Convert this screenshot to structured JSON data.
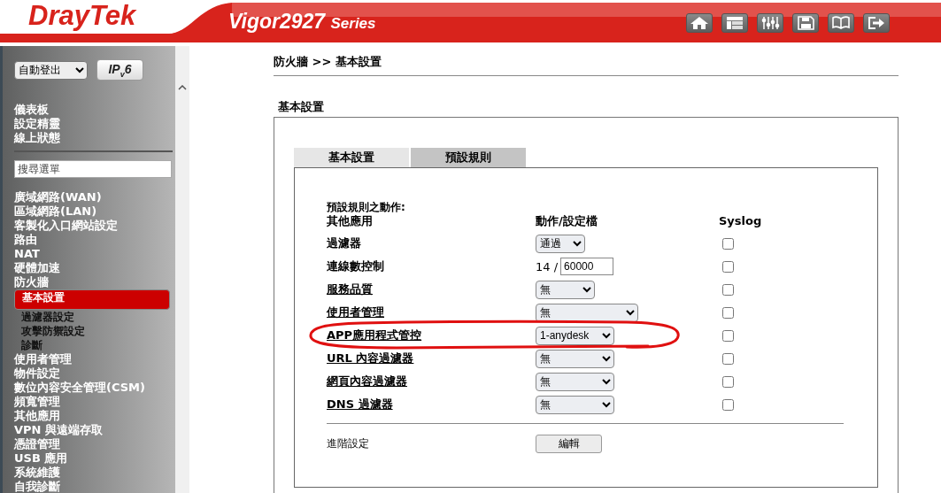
{
  "header": {
    "logo": "DrayTek",
    "model": "Vigor2927",
    "series": "Series"
  },
  "sidebar": {
    "logout_select": "自動登出",
    "ipv6_button": "IP$_{v}$6",
    "top_items": [
      {
        "label": "儀表板",
        "selected": false
      },
      {
        "label": "設定精靈",
        "selected": false
      },
      {
        "label": "線上狀態",
        "selected": false
      }
    ],
    "search": {
      "placeholder": "搜尋選單"
    },
    "menu": [
      {
        "label": "廣域網路(WAN)",
        "selected": false
      },
      {
        "label": "區域網路(LAN)",
        "selected": false
      },
      {
        "label": "客製化入口網站設定",
        "selected": false
      },
      {
        "label": "路由",
        "selected": false
      },
      {
        "label": "NAT",
        "selected": false
      },
      {
        "label": "硬體加速",
        "selected": false
      },
      {
        "label": "防火牆",
        "selected": false,
        "children": [
          {
            "label": "基本設置",
            "selected": true
          },
          {
            "label": "過濾器設定",
            "selected": false
          },
          {
            "label": "攻擊防禦設定",
            "selected": false
          },
          {
            "label": "診斷",
            "selected": false
          }
        ]
      },
      {
        "label": "使用者管理",
        "selected": false
      },
      {
        "label": "物件設定",
        "selected": false
      },
      {
        "label": "數位內容安全管理(CSM)",
        "selected": false
      },
      {
        "label": "頻寬管理",
        "selected": false
      },
      {
        "label": "其他應用",
        "selected": false
      },
      {
        "label": "VPN 與遠端存取",
        "selected": false
      },
      {
        "label": "憑證管理",
        "selected": false
      },
      {
        "label": "USB 應用",
        "selected": false
      },
      {
        "label": "系統維護",
        "selected": false
      },
      {
        "label": "自我診斷",
        "selected": false
      }
    ]
  },
  "content": {
    "breadcrumb": "防火牆 >> 基本設置",
    "section_title": "基本設置",
    "tabs": [
      {
        "label": "基本設置",
        "selected": false
      },
      {
        "label": "預設規則",
        "selected": true
      }
    ],
    "panel": {
      "heading": "預設規則之動作:",
      "columns": [
        "其他應用",
        "動作/設定檔",
        "Syslog"
      ],
      "rows": [
        {
          "label": "過濾器",
          "link": false,
          "kind": "select",
          "value": "通過",
          "syslog": false
        },
        {
          "label": "連線數控制",
          "link": false,
          "kind": "count",
          "count": "14 /",
          "value": "60000",
          "syslog": false
        },
        {
          "label": "服務品質",
          "link": true,
          "kind": "select",
          "value": "無",
          "syslog": false
        },
        {
          "label": "使用者管理",
          "link": true,
          "kind": "select",
          "value": "無",
          "syslog": false
        },
        {
          "label": "APP應用程式管控",
          "link": true,
          "kind": "select",
          "value": "1-anydesk",
          "syslog": false
        },
        {
          "label": "URL 內容過濾器",
          "link": true,
          "kind": "select",
          "value": "無",
          "syslog": false
        },
        {
          "label": "網頁內容過濾器",
          "link": true,
          "kind": "select",
          "value": "無",
          "syslog": false
        },
        {
          "label": "DNS 過濾器",
          "link": true,
          "kind": "select",
          "value": "無",
          "syslog": false
        }
      ],
      "advanced": {
        "label": "進階設定",
        "button": "編輯"
      }
    }
  }
}
